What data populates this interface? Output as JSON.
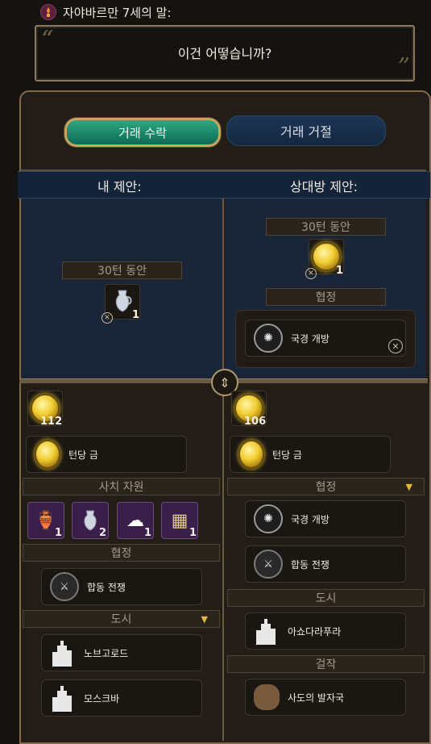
{
  "speaker": {
    "name": "자야바르만 7세의 말:",
    "icon": "incense-icon"
  },
  "speech": {
    "text": "이건 어떻습니까?"
  },
  "actions": {
    "accept_label": "거래 수락",
    "reject_label": "거래 거절"
  },
  "columns": {
    "mine_title": "내 제안:",
    "theirs_title": "상대방 제안:"
  },
  "my_offer": {
    "duration": "30턴 동안",
    "item_count": "1",
    "item_icon": "pitcher-icon"
  },
  "their_offer": {
    "duration": "30턴 동안",
    "gold_count": "1",
    "gold_icon": "gold-coin-icon",
    "agreement_label": "협정",
    "agreement_item": "국경 개방"
  },
  "my_inventory": {
    "gold_total": "112",
    "per_turn_gold": "턴당 금",
    "luxury_label": "사치 자원",
    "luxuries": [
      {
        "icon": "incense-icon",
        "count": "1"
      },
      {
        "icon": "pitcher-icon",
        "count": "2"
      },
      {
        "icon": "cotton-icon",
        "count": "1"
      },
      {
        "icon": "tea-icon",
        "count": "1"
      }
    ],
    "agreement_label": "협정",
    "agreements": [
      {
        "label": "합동 전쟁"
      }
    ],
    "city_label": "도시",
    "cities": [
      {
        "label": "노브고로드"
      },
      {
        "label": "모스크바"
      }
    ]
  },
  "their_inventory": {
    "gold_total": "106",
    "per_turn_gold": "턴당 금",
    "agreement_label": "협정",
    "agreements": [
      {
        "label": "국경 개방"
      },
      {
        "label": "합동 전쟁"
      }
    ],
    "city_label": "도시",
    "cities": [
      {
        "label": "아쇼다라푸라"
      }
    ],
    "great_works_label": "걸작",
    "great_works": [
      {
        "label": "사도의 발자국"
      }
    ]
  },
  "colors": {
    "accept": "#1e8c6c",
    "reject": "#1a3050",
    "gold": "#f0cc30",
    "border": "#8c7a5c"
  }
}
